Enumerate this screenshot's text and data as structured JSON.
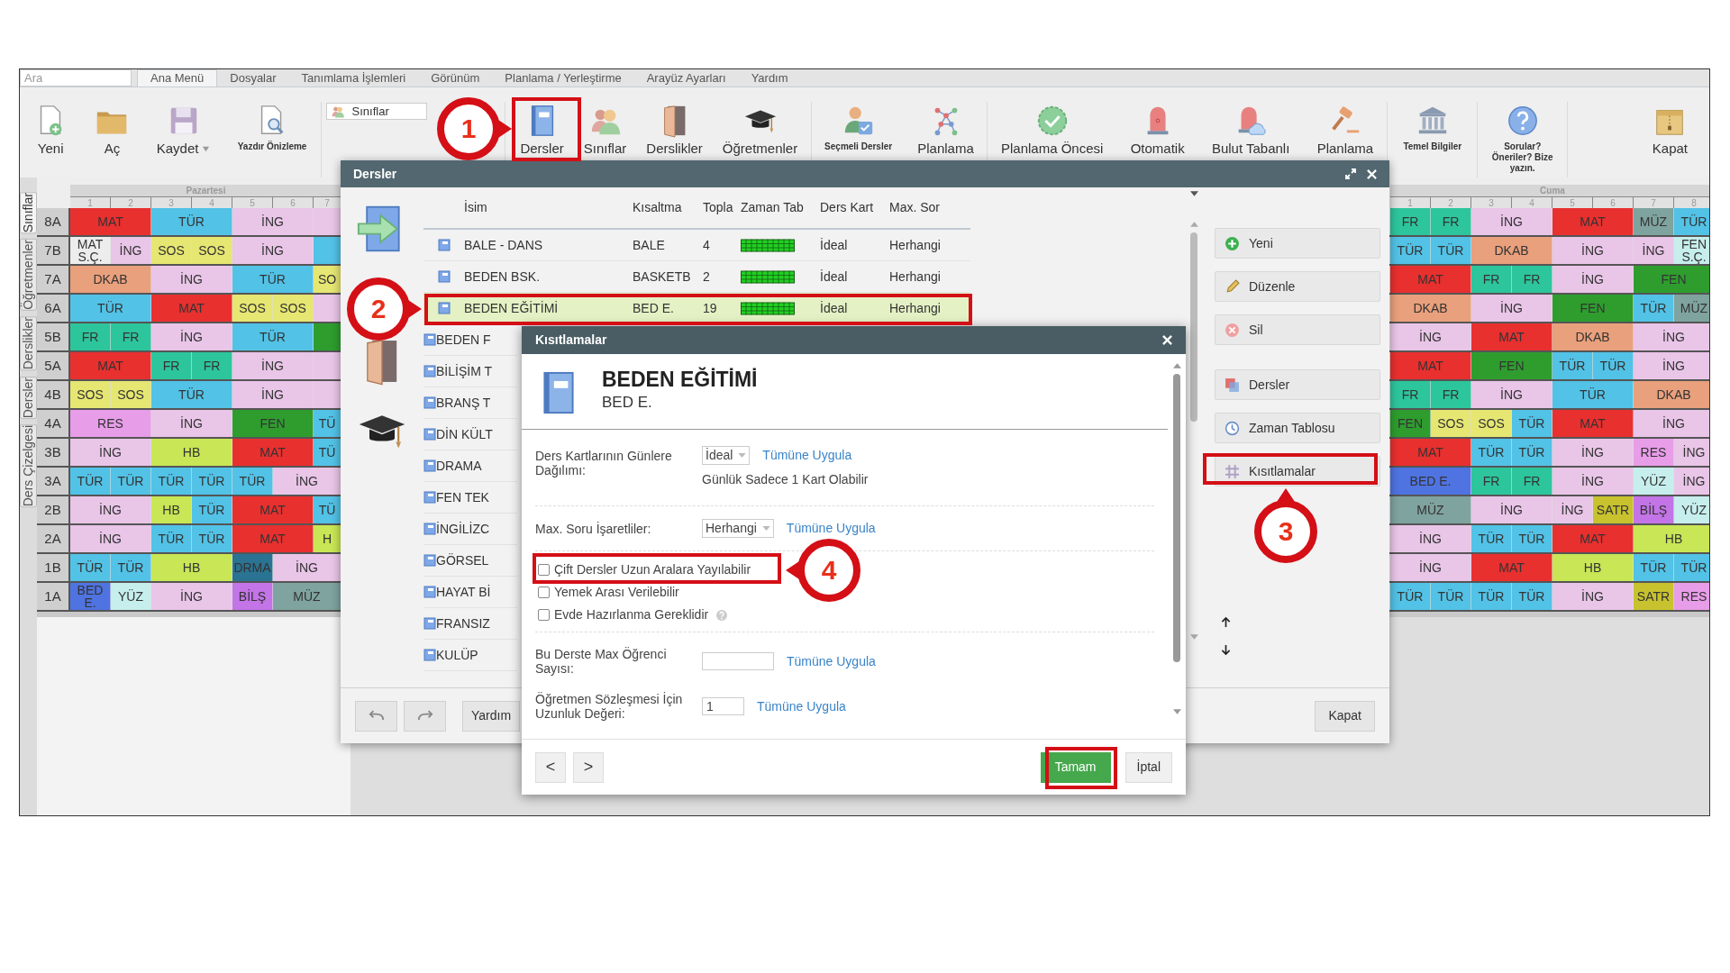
{
  "search": {
    "placeholder": "Ara"
  },
  "menu_tabs": [
    {
      "label": "Ana Menü",
      "selected": true
    },
    {
      "label": "Dosyalar",
      "selected": false
    },
    {
      "label": "Tanımlama İşlemleri",
      "selected": false
    },
    {
      "label": "Görünüm",
      "selected": false
    },
    {
      "label": "Planlama / Yerleştirme",
      "selected": false
    },
    {
      "label": "Arayüz Ayarları",
      "selected": false
    },
    {
      "label": "Yardım",
      "selected": false
    }
  ],
  "toolbar": {
    "groups": [
      {
        "items": [
          {
            "kind": "large",
            "label": "Yeni"
          },
          {
            "kind": "large",
            "label": "Aç"
          },
          {
            "kind": "menu",
            "label": "Kaydet"
          },
          {
            "kind": "small",
            "label": "Yazdır Önizleme"
          }
        ]
      },
      {
        "items": [
          {
            "kind": "dropdown",
            "label": "Sınıflar"
          }
        ]
      },
      {
        "items": [
          {
            "kind": "large",
            "label": "Dersler"
          },
          {
            "kind": "large",
            "label": "Sınıflar"
          },
          {
            "kind": "large",
            "label": "Derslikler"
          },
          {
            "kind": "large",
            "label": "Öğretmenler"
          }
        ]
      },
      {
        "items": [
          {
            "kind": "small",
            "label": "Seçmeli Dersler"
          },
          {
            "kind": "large",
            "label": "Planlama"
          }
        ]
      },
      {
        "items": [
          {
            "kind": "large",
            "label": "Planlama Öncesi"
          },
          {
            "kind": "large",
            "label": "Otomatik"
          },
          {
            "kind": "large",
            "label": "Bulut Tabanlı"
          },
          {
            "kind": "large",
            "label": "Planlama"
          }
        ]
      },
      {
        "items": [
          {
            "kind": "small",
            "label": "Temel Bilgiler"
          }
        ]
      },
      {
        "items": [
          {
            "kind": "small",
            "label": "Sorular? Öneriler? Bize yazın."
          }
        ]
      },
      {
        "items": [
          {
            "kind": "large",
            "label": "Kapat"
          }
        ]
      }
    ]
  },
  "side_tabs": [
    {
      "label": "Sınıflar",
      "selected": true
    },
    {
      "label": "Öğretmenler",
      "selected": false
    },
    {
      "label": "Derslikler",
      "selected": false
    },
    {
      "label": "Dersler",
      "selected": false
    },
    {
      "label": "Ders Çizelgesi",
      "selected": false
    }
  ],
  "timetable": {
    "days": [
      {
        "label": "Pazartesi",
        "periods": [
          "1",
          "2",
          "3",
          "4",
          "5",
          "6",
          "7"
        ]
      },
      {
        "label": "Cuma",
        "periods": [
          "1",
          "2",
          "3",
          "4",
          "5",
          "6",
          "7",
          "8"
        ]
      }
    ],
    "rows": [
      {
        "class": "8A",
        "left": [
          {
            "text": "MAT",
            "kind": "double",
            "color": "#e8302f"
          },
          {
            "text": "TÜR",
            "kind": "double",
            "color": "#52c2e6"
          },
          {
            "text": "İNG",
            "kind": "double",
            "color": "#e9c5e8"
          },
          {
            "kind": "partial",
            "color": "#e9c5e8"
          }
        ],
        "right": [
          {
            "text": "FR",
            "kind": "single",
            "color": "#2dc59c"
          },
          {
            "text": "FR",
            "kind": "single",
            "color": "#2dc59c"
          },
          {
            "text": "İNG",
            "kind": "double",
            "color": "#e9c5e8"
          },
          {
            "text": "MAT",
            "kind": "double",
            "color": "#e8302f"
          },
          {
            "text": "MÜZ",
            "kind": "single",
            "color": "#7fa39f"
          },
          {
            "text": "TÜR",
            "kind": "single",
            "color": "#52c2e6"
          }
        ]
      },
      {
        "class": "7B",
        "left": [
          {
            "text": "MAT S.Ç.",
            "kind": "single",
            "color": "#ededed"
          },
          {
            "text": "İNG",
            "kind": "single",
            "color": "#e9c5e8"
          },
          {
            "text": "SOS",
            "kind": "single",
            "color": "#e6e673"
          },
          {
            "text": "SOS",
            "kind": "single",
            "color": "#e6e673"
          },
          {
            "text": "İNG",
            "kind": "double",
            "color": "#e9c5e8"
          },
          {
            "kind": "partial",
            "color": "#52c2e6"
          }
        ],
        "right": [
          {
            "text": "TÜR",
            "kind": "single",
            "color": "#52c2e6"
          },
          {
            "text": "TÜR",
            "kind": "single",
            "color": "#52c2e6"
          },
          {
            "text": "DKAB",
            "kind": "double",
            "color": "#e9a07c"
          },
          {
            "text": "İNG",
            "kind": "double",
            "color": "#e9c5e8"
          },
          {
            "text": "İNG",
            "kind": "single",
            "color": "#e9c5e8"
          },
          {
            "text": "FEN S.Ç.",
            "kind": "single",
            "color": "#c6eeec"
          }
        ]
      },
      {
        "class": "7A",
        "left": [
          {
            "text": "DKAB",
            "kind": "double",
            "color": "#e9a07c"
          },
          {
            "text": "İNG",
            "kind": "double",
            "color": "#e9c5e8"
          },
          {
            "text": "TÜR",
            "kind": "double",
            "color": "#52c2e6"
          },
          {
            "text": "SO",
            "kind": "partial",
            "color": "#e6e673"
          }
        ],
        "right": [
          {
            "text": "MAT",
            "kind": "double",
            "color": "#e8302f"
          },
          {
            "text": "FR",
            "kind": "single",
            "color": "#2dc59c"
          },
          {
            "text": "FR",
            "kind": "single",
            "color": "#2dc59c"
          },
          {
            "text": "İNG",
            "kind": "double",
            "color": "#e9c5e8"
          },
          {
            "text": "FEN",
            "kind": "double",
            "color": "#2e9d2e"
          }
        ]
      },
      {
        "class": "6A",
        "left": [
          {
            "text": "TÜR",
            "kind": "double",
            "color": "#52c2e6"
          },
          {
            "text": "MAT",
            "kind": "double",
            "color": "#e8302f"
          },
          {
            "text": "SOS",
            "kind": "single",
            "color": "#e6e673"
          },
          {
            "text": "SOS",
            "kind": "single",
            "color": "#e6e673"
          },
          {
            "kind": "partial",
            "color": "#e9c5e8"
          }
        ],
        "right": [
          {
            "text": "DKAB",
            "kind": "double",
            "color": "#e9a07c"
          },
          {
            "text": "İNG",
            "kind": "double",
            "color": "#e9c5e8"
          },
          {
            "text": "FEN",
            "kind": "double",
            "color": "#2e9d2e"
          },
          {
            "text": "TÜR",
            "kind": "single",
            "color": "#52c2e6"
          },
          {
            "text": "MÜZ",
            "kind": "single",
            "color": "#7fa39f"
          }
        ]
      },
      {
        "class": "5B",
        "left": [
          {
            "text": "FR",
            "kind": "single",
            "color": "#2dc59c"
          },
          {
            "text": "FR",
            "kind": "single",
            "color": "#2dc59c"
          },
          {
            "text": "İNG",
            "kind": "double",
            "color": "#e9c5e8"
          },
          {
            "text": "TÜR",
            "kind": "double",
            "color": "#52c2e6"
          },
          {
            "kind": "partial",
            "color": "#2e9d2e"
          }
        ],
        "right": [
          {
            "text": "İNG",
            "kind": "double",
            "color": "#e9c5e8"
          },
          {
            "text": "MAT",
            "kind": "double",
            "color": "#e8302f"
          },
          {
            "text": "DKAB",
            "kind": "double",
            "color": "#e9a07c"
          },
          {
            "text": "İNG",
            "kind": "double",
            "color": "#e9c5e8"
          }
        ]
      },
      {
        "class": "5A",
        "left": [
          {
            "text": "MAT",
            "kind": "double",
            "color": "#e8302f"
          },
          {
            "text": "FR",
            "kind": "single",
            "color": "#2dc59c"
          },
          {
            "text": "FR",
            "kind": "single",
            "color": "#2dc59c"
          },
          {
            "text": "İNG",
            "kind": "double",
            "color": "#e9c5e8"
          },
          {
            "kind": "partial",
            "color": "#e9c5e8"
          }
        ],
        "right": [
          {
            "text": "MAT",
            "kind": "double",
            "color": "#e8302f"
          },
          {
            "text": "FEN",
            "kind": "double",
            "color": "#2e9d2e"
          },
          {
            "text": "TÜR",
            "kind": "single",
            "color": "#52c2e6"
          },
          {
            "text": "TÜR",
            "kind": "single",
            "color": "#52c2e6"
          },
          {
            "text": "İNG",
            "kind": "double",
            "color": "#e9c5e8"
          }
        ]
      },
      {
        "class": "4B",
        "left": [
          {
            "text": "SOS",
            "kind": "single",
            "color": "#e6e673"
          },
          {
            "text": "SOS",
            "kind": "single",
            "color": "#e6e673"
          },
          {
            "text": "TÜR",
            "kind": "double",
            "color": "#52c2e6"
          },
          {
            "text": "İNG",
            "kind": "double",
            "color": "#e9c5e8"
          },
          {
            "kind": "partial",
            "color": "#e9c5e8"
          }
        ],
        "right": [
          {
            "text": "FR",
            "kind": "single",
            "color": "#2dc59c"
          },
          {
            "text": "FR",
            "kind": "single",
            "color": "#2dc59c"
          },
          {
            "text": "İNG",
            "kind": "double",
            "color": "#e9c5e8"
          },
          {
            "text": "TÜR",
            "kind": "double",
            "color": "#52c2e6"
          },
          {
            "text": "DKAB",
            "kind": "double",
            "color": "#e9a07c"
          }
        ]
      },
      {
        "class": "4A",
        "left": [
          {
            "text": "RES",
            "kind": "double",
            "color": "#e89de8"
          },
          {
            "text": "İNG",
            "kind": "double",
            "color": "#e9c5e8"
          },
          {
            "text": "FEN",
            "kind": "double",
            "color": "#2e9d2e"
          },
          {
            "text": "TÜ",
            "kind": "partial",
            "color": "#52c2e6"
          }
        ],
        "right": [
          {
            "text": "FEN",
            "kind": "single",
            "color": "#2e9d2e"
          },
          {
            "text": "SOS",
            "kind": "single",
            "color": "#e6e673"
          },
          {
            "text": "SOS",
            "kind": "single",
            "color": "#e6e673"
          },
          {
            "text": "TÜR",
            "kind": "single",
            "color": "#52c2e6"
          },
          {
            "text": "MAT",
            "kind": "double",
            "color": "#e8302f"
          },
          {
            "text": "İNG",
            "kind": "double",
            "color": "#e9c5e8"
          }
        ]
      },
      {
        "class": "3B",
        "left": [
          {
            "text": "İNG",
            "kind": "double",
            "color": "#e9c5e8"
          },
          {
            "text": "HB",
            "kind": "double",
            "color": "#c8e655"
          },
          {
            "text": "MAT",
            "kind": "double",
            "color": "#e8302f"
          },
          {
            "text": "TÜ",
            "kind": "partial",
            "color": "#52c2e6"
          }
        ],
        "right": [
          {
            "text": "MAT",
            "kind": "double",
            "color": "#e8302f"
          },
          {
            "text": "TÜR",
            "kind": "single",
            "color": "#52c2e6"
          },
          {
            "text": "TÜR",
            "kind": "single",
            "color": "#52c2e6"
          },
          {
            "text": "İNG",
            "kind": "double",
            "color": "#e9c5e8"
          },
          {
            "text": "RES",
            "kind": "single",
            "color": "#e89de8"
          },
          {
            "text": "İNG",
            "kind": "single",
            "color": "#e9c5e8"
          }
        ]
      },
      {
        "class": "3A",
        "left": [
          {
            "text": "TÜR",
            "kind": "single",
            "color": "#52c2e6"
          },
          {
            "text": "TÜR",
            "kind": "single",
            "color": "#52c2e6"
          },
          {
            "text": "TÜR",
            "kind": "single",
            "color": "#52c2e6"
          },
          {
            "text": "TÜR",
            "kind": "single",
            "color": "#52c2e6"
          },
          {
            "text": "TÜR",
            "kind": "single",
            "color": "#52c2e6"
          },
          {
            "text": "İNG",
            "kind": "wide",
            "color": "#e9c5e8"
          }
        ],
        "right": [
          {
            "text": "BED E.",
            "kind": "double",
            "color": "#4f73e0"
          },
          {
            "text": "FR",
            "kind": "single",
            "color": "#2dc59c"
          },
          {
            "text": "FR",
            "kind": "single",
            "color": "#2dc59c"
          },
          {
            "text": "İNG",
            "kind": "double",
            "color": "#e9c5e8"
          },
          {
            "text": "YÜZ",
            "kind": "single",
            "color": "#c6eeec"
          },
          {
            "text": "İNG",
            "kind": "single",
            "color": "#e9c5e8"
          }
        ]
      },
      {
        "class": "2B",
        "left": [
          {
            "text": "İNG",
            "kind": "double",
            "color": "#e9c5e8"
          },
          {
            "text": "HB",
            "kind": "single",
            "color": "#c8e655"
          },
          {
            "text": "TÜR",
            "kind": "single",
            "color": "#52c2e6"
          },
          {
            "text": "MAT",
            "kind": "double",
            "color": "#e8302f"
          },
          {
            "text": "TÜ",
            "kind": "partial",
            "color": "#52c2e6"
          }
        ],
        "right": [
          {
            "text": "MÜZ",
            "kind": "double",
            "color": "#7fa39f"
          },
          {
            "text": "İNG",
            "kind": "double",
            "color": "#e9c5e8"
          },
          {
            "text": "İNG",
            "kind": "single",
            "color": "#e9c5e8"
          },
          {
            "text": "SATR",
            "kind": "single",
            "color": "#c7c22e"
          },
          {
            "text": "BİLŞ",
            "kind": "single",
            "color": "#c374e6"
          },
          {
            "text": "YÜZ",
            "kind": "single",
            "color": "#c6eeec"
          }
        ]
      },
      {
        "class": "2A",
        "left": [
          {
            "text": "İNG",
            "kind": "double",
            "color": "#e9c5e8"
          },
          {
            "text": "TÜR",
            "kind": "single",
            "color": "#52c2e6"
          },
          {
            "text": "TÜR",
            "kind": "single",
            "color": "#52c2e6"
          },
          {
            "text": "MAT",
            "kind": "double",
            "color": "#e8302f"
          },
          {
            "text": "H",
            "kind": "partial",
            "color": "#c8e655"
          }
        ],
        "right": [
          {
            "text": "İNG",
            "kind": "double",
            "color": "#e9c5e8"
          },
          {
            "text": "TÜR",
            "kind": "single",
            "color": "#52c2e6"
          },
          {
            "text": "TÜR",
            "kind": "single",
            "color": "#52c2e6"
          },
          {
            "text": "MAT",
            "kind": "double",
            "color": "#e8302f"
          },
          {
            "text": "HB",
            "kind": "double",
            "color": "#c8e655"
          }
        ]
      },
      {
        "class": "1B",
        "left": [
          {
            "text": "TÜR",
            "kind": "single",
            "color": "#52c2e6"
          },
          {
            "text": "TÜR",
            "kind": "single",
            "color": "#52c2e6"
          },
          {
            "text": "HB",
            "kind": "double",
            "color": "#c8e655"
          },
          {
            "text": "DRMA",
            "kind": "single",
            "color": "#2b7392"
          },
          {
            "text": "İNG",
            "kind": "wide",
            "color": "#e9c5e8"
          }
        ],
        "right": [
          {
            "text": "İNG",
            "kind": "double",
            "color": "#e9c5e8"
          },
          {
            "text": "MAT",
            "kind": "double",
            "color": "#e8302f"
          },
          {
            "text": "HB",
            "kind": "double",
            "color": "#c8e655"
          },
          {
            "text": "TÜR",
            "kind": "single",
            "color": "#52c2e6"
          },
          {
            "text": "TÜR",
            "kind": "single",
            "color": "#52c2e6"
          }
        ]
      },
      {
        "class": "1A",
        "left": [
          {
            "text": "BED E.",
            "kind": "single",
            "color": "#4f73e0"
          },
          {
            "text": "YÜZ",
            "kind": "single",
            "color": "#c6eeec"
          },
          {
            "text": "İNG",
            "kind": "double",
            "color": "#e9c5e8"
          },
          {
            "text": "BİLŞ",
            "kind": "single",
            "color": "#c374e6"
          },
          {
            "text": "MÜZ",
            "kind": "wide",
            "color": "#7fa39f"
          }
        ],
        "right": [
          {
            "text": "TÜR",
            "kind": "single",
            "color": "#52c2e6"
          },
          {
            "text": "TÜR",
            "kind": "single",
            "color": "#52c2e6"
          },
          {
            "text": "TÜR",
            "kind": "single",
            "color": "#52c2e6"
          },
          {
            "text": "TÜR",
            "kind": "single",
            "color": "#52c2e6"
          },
          {
            "text": "İNG",
            "kind": "double",
            "color": "#e9c5e8"
          },
          {
            "text": "SATR",
            "kind": "single",
            "color": "#c7c22e"
          },
          {
            "text": "RES",
            "kind": "single",
            "color": "#e89de8"
          }
        ]
      }
    ]
  },
  "lessons_dialog": {
    "title": "Dersler",
    "columns": [
      "İsim",
      "Kısaltma",
      "Topla",
      "Zaman Tab",
      "Ders Kart",
      "Max. Sor"
    ],
    "rows": [
      {
        "kind": "full",
        "name": "BALE - DANS",
        "short": "BALE",
        "total": "4",
        "distribution": "İdeal",
        "max": "Herhangi",
        "selected": false
      },
      {
        "kind": "full",
        "name": "BEDEN BSK.",
        "short": "BASKETB",
        "total": "2",
        "distribution": "İdeal",
        "max": "Herhangi",
        "selected": false
      },
      {
        "kind": "full",
        "name": "BEDEN EĞİTİMİ",
        "short": "BED E.",
        "total": "19",
        "distribution": "İdeal",
        "max": "Herhangi",
        "selected": true
      },
      {
        "kind": "covered",
        "name": "BEDEN F",
        "selected": false
      },
      {
        "kind": "covered",
        "name": "BİLİŞİM T",
        "selected": false
      },
      {
        "kind": "covered",
        "name": "BRANŞ T",
        "selected": false
      },
      {
        "kind": "covered",
        "name": "DİN KÜLT",
        "selected": false
      },
      {
        "kind": "covered",
        "name": "DRAMA",
        "selected": false
      },
      {
        "kind": "covered",
        "name": "FEN TEK",
        "selected": false
      },
      {
        "kind": "covered",
        "name": "İNGİLİZC",
        "selected": false
      },
      {
        "kind": "covered",
        "name": "GÖRSEL",
        "selected": false
      },
      {
        "kind": "covered",
        "name": "HAYAT Bİ",
        "selected": false
      },
      {
        "kind": "covered",
        "name": "FRANSIZ",
        "selected": false
      },
      {
        "kind": "covered",
        "name": "KULÜP",
        "selected": false
      }
    ],
    "actions": [
      {
        "label": "Yeni"
      },
      {
        "label": "Düzenle"
      },
      {
        "label": "Sil"
      },
      {
        "label": "Dersler"
      },
      {
        "label": "Zaman Tablosu"
      },
      {
        "label": "Kısıtlamalar"
      }
    ],
    "help": "Yardım",
    "close": "Kapat"
  },
  "constraints_dialog": {
    "title": "Kısıtlamalar",
    "heading": "BEDEN EĞİTİMİ",
    "subheading": "BED E.",
    "fields": [
      {
        "kind": "select",
        "label": "Ders Kartlarının Günlere Dağılımı:",
        "value": "İdeal",
        "link": "Tümüne Uygula",
        "note": "Günlük Sadece 1 Kart Olabilir"
      },
      {
        "kind": "select",
        "label": "Max. Soru İşaretliler:",
        "value": "Herhangi",
        "link": "Tümüne Uygula"
      },
      {
        "kind": "checks",
        "items": [
          {
            "label": "Çift Dersler Uzun Aralara Yayılabilir",
            "checked": false,
            "help": false
          },
          {
            "label": "Yemek Arası Verilebilir",
            "checked": false,
            "help": false
          },
          {
            "label": "Evde Hazırlanma Gereklidir",
            "checked": false,
            "help": true
          }
        ]
      },
      {
        "kind": "input",
        "label": "Bu Derste Max Öğrenci Sayısı:",
        "link": "Tümüne Uygula"
      },
      {
        "kind": "input",
        "label": "Öğretmen Sözleşmesi İçin Uzunluk Değeri:",
        "value": "1",
        "link": "Tümüne Uygula"
      }
    ],
    "prev": "<",
    "next": ">",
    "ok": "Tamam",
    "cancel": "İptal"
  },
  "annotations": [
    {
      "label": "1"
    },
    {
      "label": "2"
    },
    {
      "label": "3"
    },
    {
      "label": "4"
    }
  ]
}
